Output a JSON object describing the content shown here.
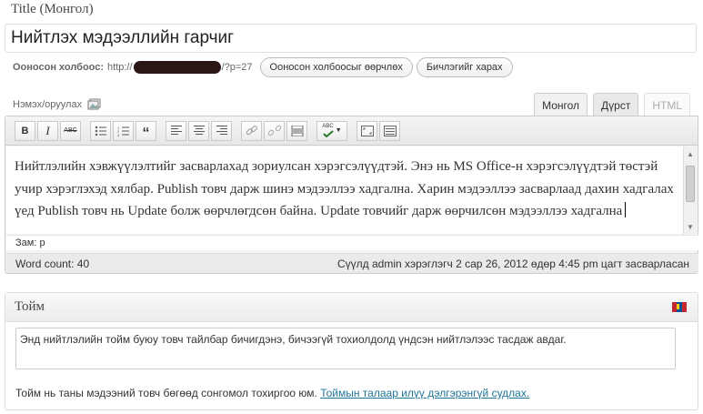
{
  "title_section": {
    "label": "Title (Монгол)",
    "value": "Нийтлэх мэдээллийн гарчиг"
  },
  "permalink": {
    "label": "Ооносон холбоос:",
    "url_prefix": "http://",
    "url_suffix": "/?p=27",
    "change_button": "Ооносон холбоосыг өөрчлөх",
    "view_button": "Бичлэгийг харах"
  },
  "upload": {
    "label": "Нэмэх/оруулах",
    "icon": "media-icon"
  },
  "editor_tabs": {
    "mongol": "Монгол",
    "visual": "Дүрст",
    "html": "HTML"
  },
  "toolbar": {
    "bold": "B",
    "italic": "I",
    "strike": "ABC",
    "spell": "ABC"
  },
  "editor": {
    "content": "Нийтлэлийн хэвжүүлэлтийг засварлахад зориулсан хэрэгсэлүүдтэй. Энэ нь MS Office-н хэрэгсэлүүдтэй төстэй учир хэрэглэхэд хялбар. Publish товч дарж шинэ мэдээллээ хадгална. Харин мэдээллээ засварлаад дахин хадгалах үед Publish товч нь Update болж өөрчлөгдсөн байна. Update товчийг дарж өөрчилсөн мэдээллээ хадгална",
    "path_label": "Зам:",
    "path_value": "p",
    "word_count": "Word count: 40",
    "last_edited": "Сүүлд admin хэрэглэгч 2 сар 26, 2012 өдөр 4:45 pm цагт засварласан"
  },
  "excerpt": {
    "title": "Тойм",
    "text": "Энд нийтлэлийн тойм буюу товч тайлбар бичигдэнэ, бичээгүй тохиолдолд үндсэн нийтлэлээс тасдаж авдаг.",
    "help_text": "Тойм нь таны мэдээний товч бөгөөд сонгомол тохиргоо юм.",
    "help_link": "Тоймын талаар илүү дэлгэрэнгүй судлах."
  },
  "colors": {
    "link": "#21759b",
    "flag_red": "#c4272f",
    "flag_blue": "#015197",
    "flag_gold": "#f9cf02"
  }
}
